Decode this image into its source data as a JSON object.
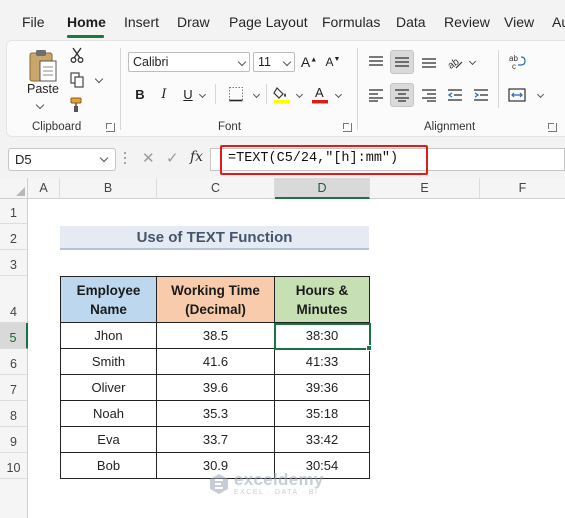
{
  "menu": {
    "items": [
      "File",
      "Home",
      "Insert",
      "Draw",
      "Page Layout",
      "Formulas",
      "Data",
      "Review",
      "View",
      "Au"
    ],
    "active": "Home"
  },
  "ribbon": {
    "clipboard": {
      "paste_label": "Paste",
      "group_label": "Clipboard"
    },
    "font": {
      "font_name": "Calibri",
      "font_size": "11",
      "bold": "B",
      "italic": "I",
      "underline": "U",
      "group_label": "Font"
    },
    "alignment": {
      "group_label": "Alignment"
    }
  },
  "formula_bar": {
    "name_box": "D5",
    "fx_label": "fx",
    "formula": "=TEXT(C5/24,\"[h]:mm\")"
  },
  "grid": {
    "columns": [
      "A",
      "B",
      "C",
      "D",
      "E",
      "F"
    ],
    "active_column": "D",
    "rows": [
      "1",
      "2",
      "3",
      "4",
      "5",
      "6",
      "7",
      "8",
      "9",
      "10"
    ],
    "active_row": "5"
  },
  "sheet": {
    "title": "Use of TEXT Function",
    "headers": [
      "Employee Name",
      "Working Time (Decimal)",
      "Hours & Minutes"
    ],
    "rows": [
      [
        "Jhon",
        "38.5",
        "38:30"
      ],
      [
        "Smith",
        "41.6",
        "41:33"
      ],
      [
        "Oliver",
        "39.6",
        "39:36"
      ],
      [
        "Noah",
        "35.3",
        "35:18"
      ],
      [
        "Eva",
        "33.7",
        "33:42"
      ],
      [
        "Bob",
        "30.9",
        "30:54"
      ]
    ]
  },
  "watermark": {
    "name": "exceldemy",
    "tagline": "EXCEL · DATA · BI"
  },
  "colors": {
    "accent": "#1e7145",
    "highlight_box": "#e01b1b",
    "header_name": "#bdd7ee",
    "header_time": "#f8cbad",
    "header_hours": "#c6e0b4",
    "title_fill": "#e6ebf3"
  }
}
